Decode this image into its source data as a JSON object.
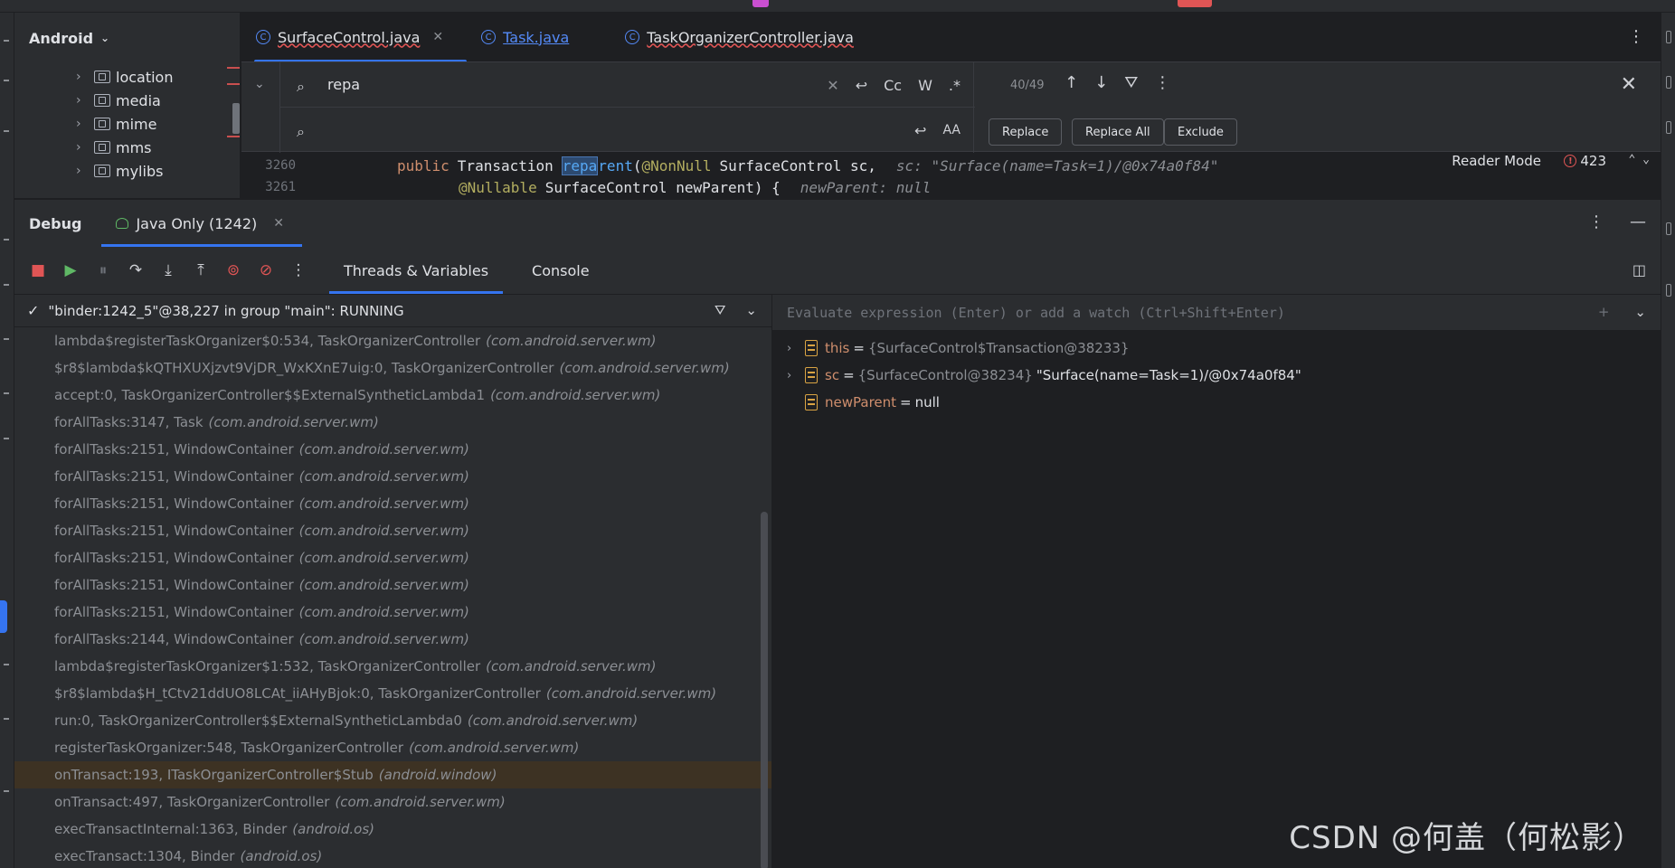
{
  "project": {
    "view_label": "Android",
    "tree": [
      {
        "label": "location"
      },
      {
        "label": "media"
      },
      {
        "label": "mime"
      },
      {
        "label": "mms"
      },
      {
        "label": "mylibs"
      }
    ]
  },
  "editor": {
    "tabs": [
      {
        "label": "SurfaceControl.java",
        "active": true
      },
      {
        "label": "Task.java",
        "active": false
      },
      {
        "label": "TaskOrganizerController.java",
        "active": false
      }
    ],
    "find": {
      "query": "repa",
      "replace_value": "",
      "match_count": "40/49",
      "option_case": "Cc",
      "option_words": "W",
      "option_regex": ".*",
      "option_preserve_case": "AA",
      "replace_label": "Replace",
      "replace_all_label": "Replace All",
      "exclude_label": "Exclude"
    },
    "code": {
      "line1_number": "3260",
      "line1_kw": "public",
      "line1_type": "Transaction",
      "line1_match": "repa",
      "line1_fn_rest": "rent",
      "line1_paren": "(",
      "line1_ann": "@NonNull",
      "line1_params": "SurfaceControl sc,",
      "line1_hint": "sc: \"Surface(name=Task=1)/@0x74a0f84\"",
      "line2_number": "3261",
      "line2_ann": "@Nullable",
      "line2_params": "SurfaceControl newParent) {",
      "line2_hint": "newParent: null"
    },
    "reader_mode_label": "Reader Mode",
    "error_count": "423"
  },
  "debug": {
    "title": "Debug",
    "session_label": "Java Only (1242)",
    "tabs": [
      {
        "label": "Threads & Variables",
        "active": true
      },
      {
        "label": "Console",
        "active": false
      }
    ],
    "thread_label": "\"binder:1242_5\"@38,227 in group \"main\": RUNNING",
    "frames": [
      {
        "method": "lambda$registerTaskOrganizer$0:534, TaskOrganizerController",
        "pkg": "(com.android.server.wm)"
      },
      {
        "method": "$r8$lambda$kQTHXUXjzvt9VjDR_WxKXnE7uig:0, TaskOrganizerController",
        "pkg": "(com.android.server.wm)"
      },
      {
        "method": "accept:0, TaskOrganizerController$$ExternalSyntheticLambda1",
        "pkg": "(com.android.server.wm)"
      },
      {
        "method": "forAllTasks:3147, Task",
        "pkg": "(com.android.server.wm)"
      },
      {
        "method": "forAllTasks:2151, WindowContainer",
        "pkg": "(com.android.server.wm)"
      },
      {
        "method": "forAllTasks:2151, WindowContainer",
        "pkg": "(com.android.server.wm)"
      },
      {
        "method": "forAllTasks:2151, WindowContainer",
        "pkg": "(com.android.server.wm)"
      },
      {
        "method": "forAllTasks:2151, WindowContainer",
        "pkg": "(com.android.server.wm)"
      },
      {
        "method": "forAllTasks:2151, WindowContainer",
        "pkg": "(com.android.server.wm)"
      },
      {
        "method": "forAllTasks:2151, WindowContainer",
        "pkg": "(com.android.server.wm)"
      },
      {
        "method": "forAllTasks:2151, WindowContainer",
        "pkg": "(com.android.server.wm)"
      },
      {
        "method": "forAllTasks:2144, WindowContainer",
        "pkg": "(com.android.server.wm)"
      },
      {
        "method": "lambda$registerTaskOrganizer$1:532, TaskOrganizerController",
        "pkg": "(com.android.server.wm)"
      },
      {
        "method": "$r8$lambda$H_tCtv21ddUO8LCAt_iiAHyBjok:0, TaskOrganizerController",
        "pkg": "(com.android.server.wm)"
      },
      {
        "method": "run:0, TaskOrganizerController$$ExternalSyntheticLambda0",
        "pkg": "(com.android.server.wm)"
      },
      {
        "method": "registerTaskOrganizer:548, TaskOrganizerController",
        "pkg": "(com.android.server.wm)"
      },
      {
        "method": "onTransact:193, ITaskOrganizerController$Stub",
        "pkg": "(android.window)",
        "current": true
      },
      {
        "method": "onTransact:497, TaskOrganizerController",
        "pkg": "(com.android.server.wm)"
      },
      {
        "method": "execTransactInternal:1363, Binder",
        "pkg": "(android.os)"
      },
      {
        "method": "execTransact:1304, Binder",
        "pkg": "(android.os)"
      }
    ],
    "eval_placeholder": "Evaluate expression (Enter) or add a watch (Ctrl+Shift+Enter)",
    "variables": [
      {
        "name": "this",
        "ref": "{SurfaceControl$Transaction@38233}",
        "str": "",
        "expandable": true
      },
      {
        "name": "sc",
        "ref": "{SurfaceControl@38234}",
        "str": "\"Surface(name=Task=1)/@0x74a0f84\"",
        "expandable": true
      },
      {
        "name": "newParent",
        "ref": "",
        "str": "null",
        "expandable": false
      }
    ]
  },
  "watermark": "CSDN @何盖（何松影）",
  "colors": {
    "accent": "#3574f0",
    "error": "#e05555",
    "keyword": "#cf8e6d",
    "annotation": "#b3ae60",
    "function": "#56a8f5",
    "current_frame_bg": "#3d3223",
    "variable_icon": "#d9a343"
  }
}
